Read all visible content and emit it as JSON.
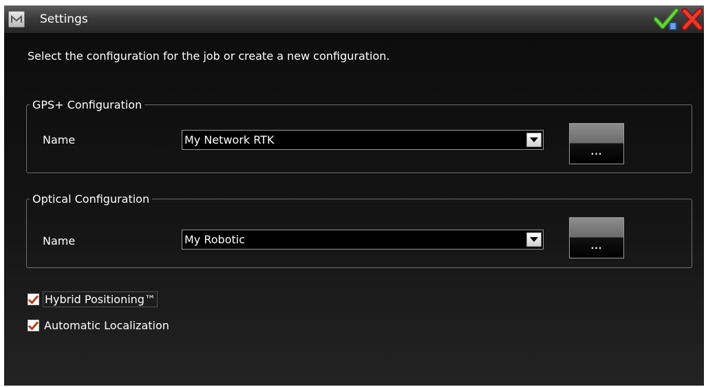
{
  "window": {
    "title": "Settings",
    "icons": {
      "app": "app-menu-icon",
      "accept": "accept-check-icon",
      "cancel": "cancel-x-icon"
    }
  },
  "instruction": "Select the configuration for the job or create a new configuration.",
  "gps_group": {
    "legend": "GPS+ Configuration",
    "name_label": "Name",
    "selected_value": "My Network RTK",
    "more_button": "..."
  },
  "optical_group": {
    "legend": "Optical Configuration",
    "name_label": "Name",
    "selected_value": "My Robotic",
    "more_button": "..."
  },
  "options": {
    "hybrid": {
      "label": "Hybrid Positioning™",
      "checked": true
    },
    "localization": {
      "label": "Automatic Localization",
      "checked": true
    }
  },
  "colors": {
    "check_mark": "#b23b1e",
    "accept_green": "#4caf2a",
    "cancel_red": "#d6261f"
  }
}
